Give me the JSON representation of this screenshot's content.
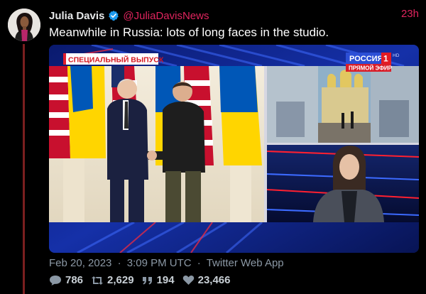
{
  "tweet": {
    "display_name": "Julia Davis",
    "handle": "@JuliaDavisNews",
    "time_ago": "23h",
    "text": "Meanwhile in Russia: lots of long faces in the studio.",
    "date": "Feb 20, 2023",
    "time": "3:09 PM UTC",
    "source": "Twitter Web App",
    "separator": "·",
    "accent_color": "#e0245e"
  },
  "media": {
    "banner_text": "СПЕЦИАЛЬНЫЙ ВЫПУСК",
    "channel_name": "РОССИЯ",
    "channel_number": "1",
    "channel_hd": "HD",
    "live_label": "ПРЯМОЙ ЭФИР"
  },
  "actions": {
    "replies": "786",
    "retweets": "2,629",
    "quotes": "194",
    "likes": "23,466",
    "icons": [
      "reply-icon",
      "retweet-icon",
      "quote-icon",
      "like-icon"
    ]
  }
}
